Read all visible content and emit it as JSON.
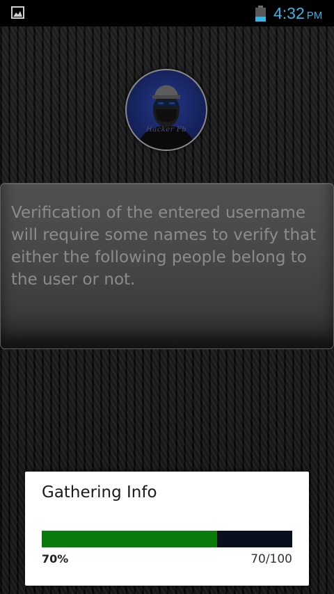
{
  "status_bar": {
    "time": "4:32",
    "ampm": "PM",
    "battery_level": 0.35,
    "notification_icon": "image-icon",
    "accent_color": "#33b5e5"
  },
  "avatar": {
    "label": "Hacker Fb",
    "icon": "hacker-avatar"
  },
  "info_panel": {
    "text": "Verification of the entered username will require some names to verify that either the following people belong to the user or not."
  },
  "dialog": {
    "title": "Gathering Info",
    "progress": {
      "value": 70,
      "max": 100,
      "percent_label": "70%",
      "count_label": "70/100",
      "fill_color": "#0a7a0a",
      "track_color": "#0a0f1e"
    }
  }
}
